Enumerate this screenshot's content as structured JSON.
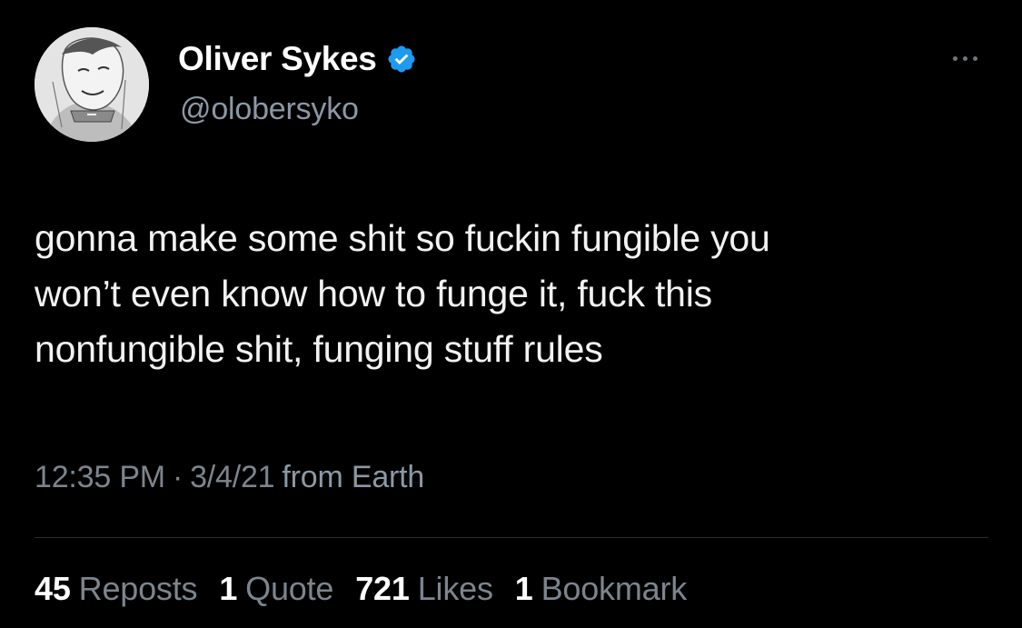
{
  "author": {
    "display_name": "Oliver Sykes",
    "handle": "@olobersyko",
    "verified": true,
    "avatar_icon": "sketch-portrait-avatar"
  },
  "tweet": {
    "text_lines": [
      "gonna make some shit so fuckin fungible you",
      "won’t even know how to funge it, fuck this",
      "nonfungible shit, funging stuff rules"
    ],
    "time": "12:35 PM",
    "separator": "·",
    "date": "3/4/21",
    "source": "from Earth"
  },
  "stats": [
    {
      "count": "45",
      "label": "Reposts"
    },
    {
      "count": "1",
      "label": "Quote"
    },
    {
      "count": "721",
      "label": "Likes"
    },
    {
      "count": "1",
      "label": "Bookmark"
    }
  ],
  "icons": {
    "more": "more-horizontal-icon",
    "verified": "verified-badge-icon"
  },
  "colors": {
    "background": "#000000",
    "text_primary": "#ffffff",
    "text_secondary": "#7c858e",
    "verified_blue": "#1d9bf0",
    "divider": "#2a2f33"
  }
}
